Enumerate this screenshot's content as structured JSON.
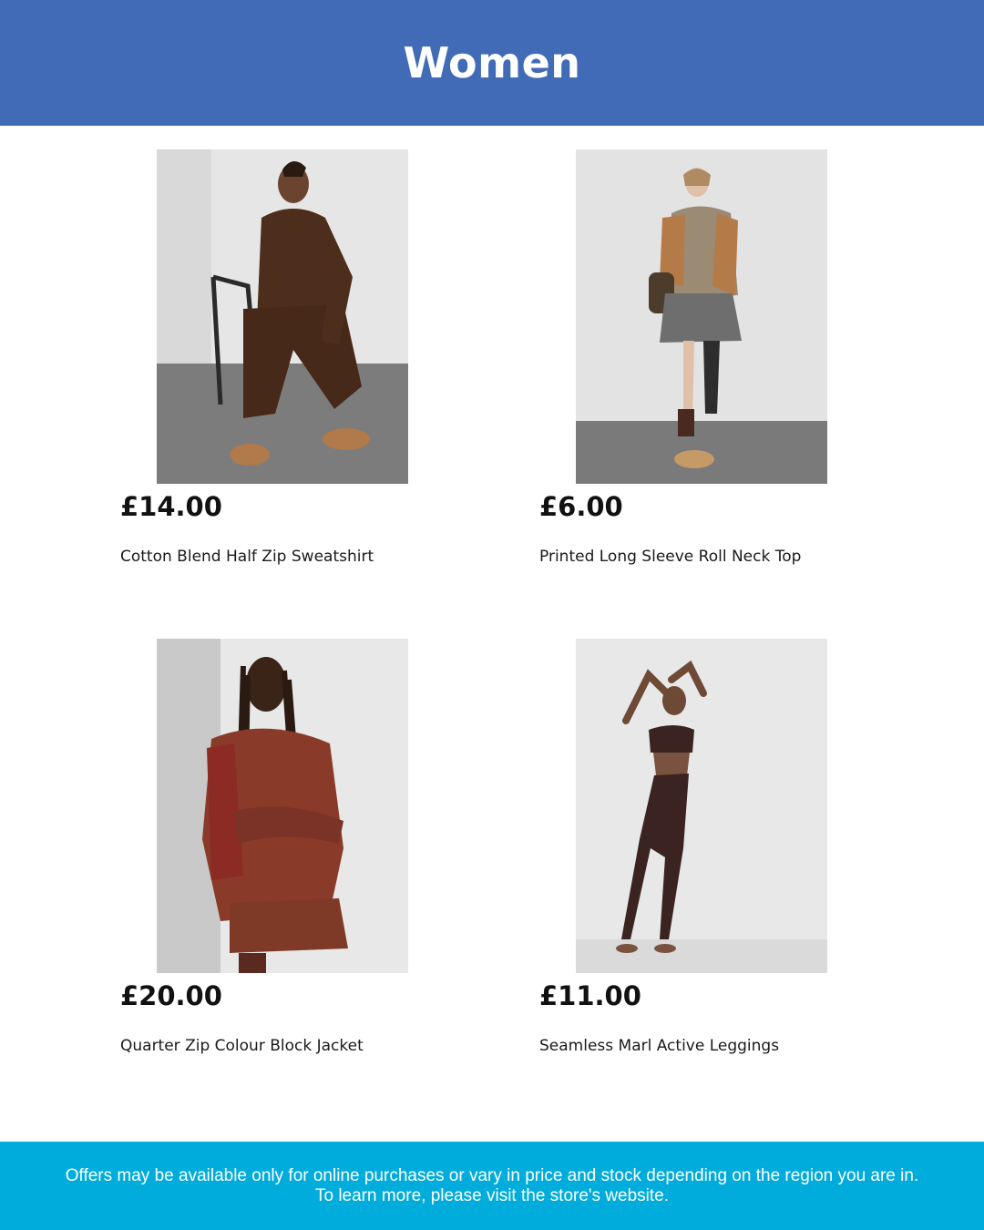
{
  "header": {
    "title": "Women"
  },
  "products": [
    {
      "price": "£14.00",
      "name": "Cotton Blend Half Zip Sweatshirt"
    },
    {
      "price": "£6.00",
      "name": "Printed Long Sleeve Roll Neck Top"
    },
    {
      "price": "£20.00",
      "name": "Quarter Zip Colour Block Jacket"
    },
    {
      "price": "£11.00",
      "name": "Seamless Marl Active Leggings"
    }
  ],
  "footer": {
    "line1": "Offers may be available only for online purchases or vary in price and stock depending on the region you are in.",
    "line2": "To learn more, please visit the store's website."
  },
  "colors": {
    "header_bg": "#416bb6",
    "footer_bg": "#00acdb"
  }
}
